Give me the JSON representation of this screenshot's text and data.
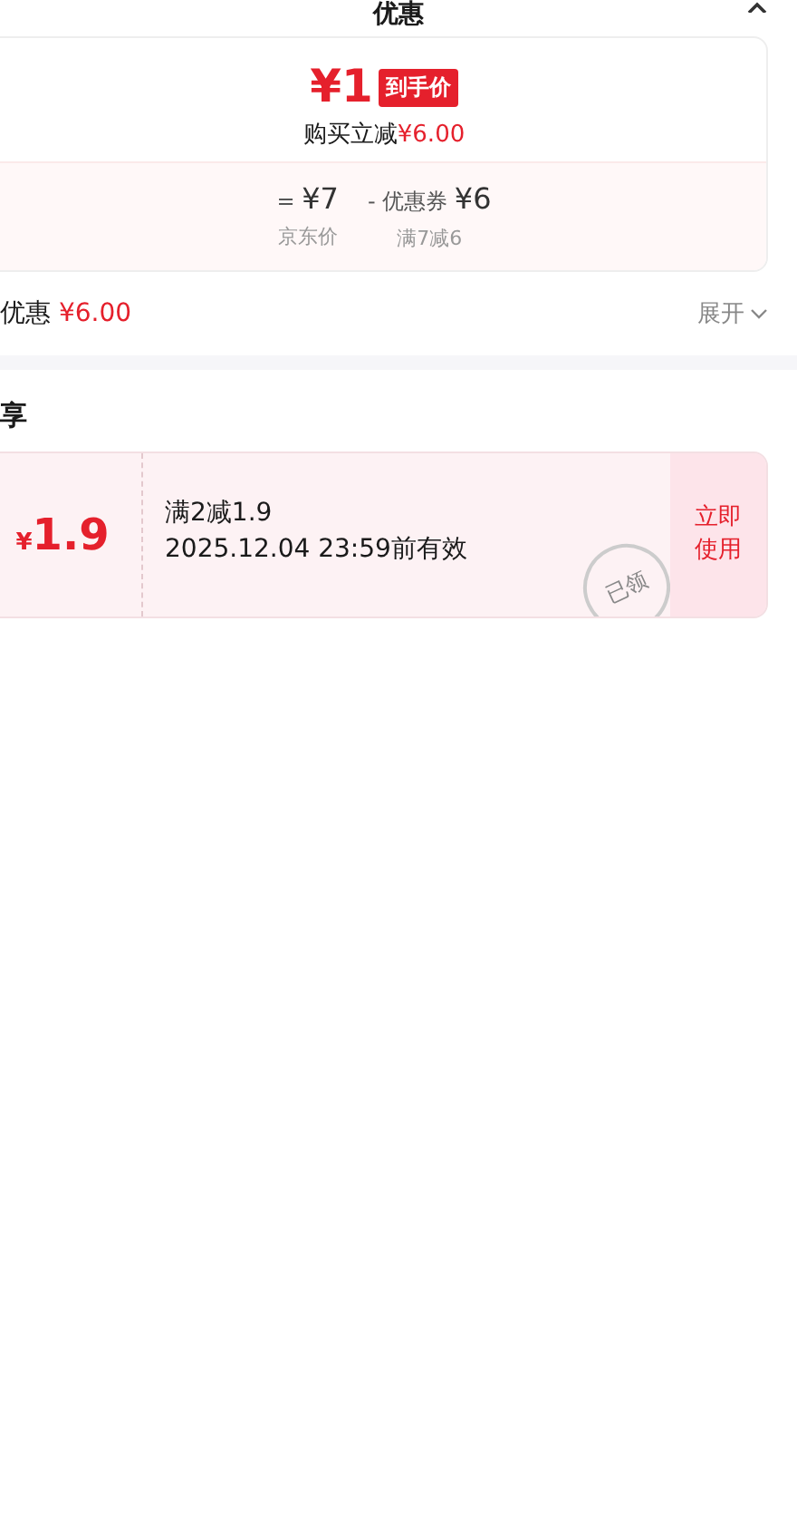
{
  "header": {
    "title": "优惠"
  },
  "summary": {
    "price": "¥1",
    "price_tag": "到手价",
    "saving_label": "购买立减",
    "saving_amount": "¥6.00",
    "breakdown": [
      {
        "op": "=",
        "value": "¥7",
        "caption": "京东价"
      },
      {
        "op": "- 优惠券",
        "value": "¥6",
        "caption": "满7减6"
      }
    ]
  },
  "total": {
    "label": "优惠",
    "amount": "¥6.00",
    "toggle": "展开"
  },
  "section": {
    "title": "享"
  },
  "coupons": [
    {
      "currency": "¥",
      "amount": "1.9",
      "rule": "满2减1.9",
      "validity": "2025.12.04 23:59前有效",
      "stamp": "已领",
      "action": "立即使用"
    }
  ]
}
